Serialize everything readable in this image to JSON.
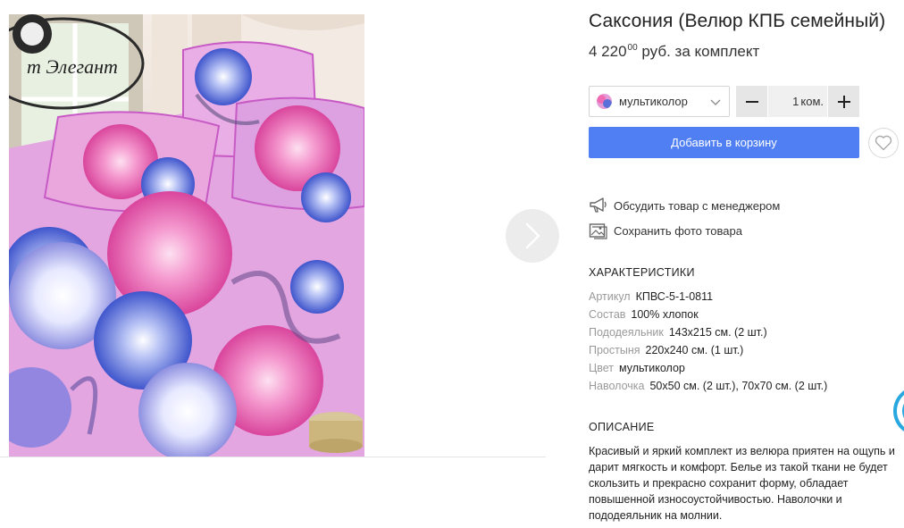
{
  "product": {
    "title": "Саксония (Велюр КПБ семейный)",
    "price_main": "4 220",
    "price_cents": "00",
    "price_unit": "руб. за комплект"
  },
  "photo": {
    "logo_text": "т Элегант"
  },
  "options": {
    "color_value": "мультиколор",
    "qty_value": "1",
    "qty_unit": "ком.",
    "minus_symbol": "−",
    "plus_symbol": "+"
  },
  "actions": {
    "add_to_cart": "Добавить в корзину",
    "discuss": "Обсудить товар с менеджером",
    "save_photo": "Сохранить фото товара"
  },
  "characteristics": {
    "heading": "ХАРАКТЕРИСТИКИ",
    "rows": [
      {
        "key": "Артикул",
        "value": "КПВС-5-1-0811"
      },
      {
        "key": "Состав",
        "value": "100% хлопок"
      },
      {
        "key": "Пододеяльник",
        "value": "143х215 см. (2 шт.)"
      },
      {
        "key": "Простыня",
        "value": "220х240 см. (1 шт.)"
      },
      {
        "key": "Цвет",
        "value": "мультиколор"
      },
      {
        "key": "Наволочка",
        "value": "50х50 см. (2 шт.), 70х70 см. (2 шт.)"
      }
    ]
  },
  "description": {
    "heading": "ОПИСАНИЕ",
    "text": "Красивый и яркий комплект из велюра приятен на ощупь и дарит мягкость и комфорт. Белье из такой ткани не будет скользить и прекрасно сохранит форму, обладает повышенной износоустойчивостью. Наволочки и пододеяльник на молнии."
  },
  "colors": {
    "accent": "#4f7ff2",
    "bed_pink": "#e59ad8",
    "flower_pink": "#f06bb3",
    "flower_blue": "#5a6fd8",
    "widget": "#29a8e0"
  },
  "icons": {
    "next": "chevron-right-icon",
    "select": "chevron-down-icon",
    "wishlist": "heart-icon",
    "discuss": "megaphone-icon",
    "save_photo": "image-icon"
  }
}
